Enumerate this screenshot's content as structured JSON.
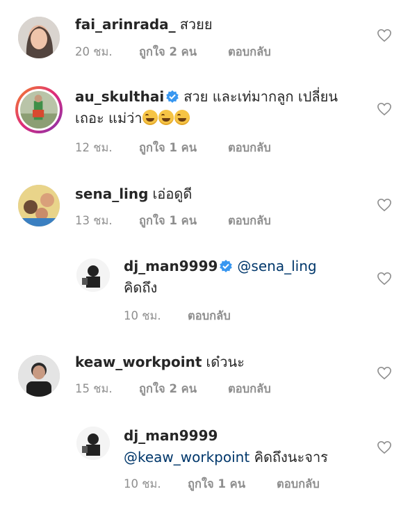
{
  "comments": [
    {
      "username": "fai_arinrada_",
      "verified": false,
      "text": "สวยย",
      "time": "20 ชม.",
      "likes": "ถูกใจ 2 คน",
      "reply": "ตอบกลับ"
    },
    {
      "username": "au_skulthai",
      "verified": true,
      "text_line1": "สวย และเท่มากลูก เปลี่ยน",
      "text_line2": "เถอะ แม่ว่า",
      "time": "12 ชม.",
      "likes": "ถูกใจ 1 คน",
      "reply": "ตอบกลับ"
    },
    {
      "username": "sena_ling",
      "verified": false,
      "text": "เอ่อดูดี",
      "time": "13 ชม.",
      "likes": "ถูกใจ 1 คน",
      "reply": "ตอบกลับ"
    },
    {
      "username": "dj_man9999",
      "verified": true,
      "mention": "@sena_ling",
      "text": "คิดถึง",
      "time": "10 ชม.",
      "reply": "ตอบกลับ"
    },
    {
      "username": "keaw_workpoint",
      "verified": false,
      "text": "เด๋วนะ",
      "time": "15 ชม.",
      "likes": "ถูกใจ 2 คน",
      "reply": "ตอบกลับ"
    },
    {
      "username": "dj_man9999",
      "verified": false,
      "mention": "@keaw_workpoint",
      "text": "คิดถึงนะจาร",
      "time": "10 ชม.",
      "likes": "ถูกใจ 1 คน",
      "reply": "ตอบกลับ"
    }
  ],
  "icons": {
    "heart": "heart-outline-icon",
    "verified": "verified-badge-icon",
    "emoji": "rolling-on-floor-laughing-emoji"
  },
  "colors": {
    "text": "#262626",
    "meta": "#8e8e8e",
    "mention": "#00376b",
    "verified": "#3897f0",
    "heart_stroke": "#8e8e8e"
  }
}
